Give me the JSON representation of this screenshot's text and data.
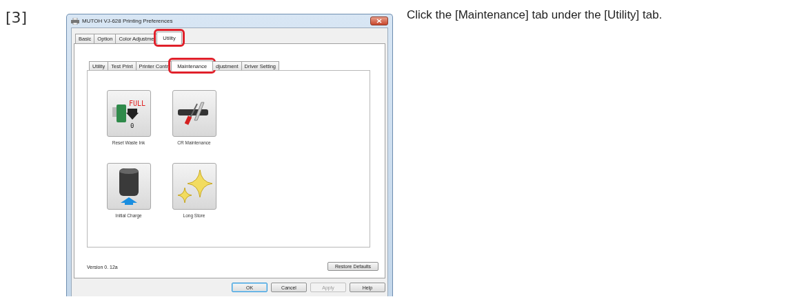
{
  "step": "[3]",
  "dialog": {
    "title": "MUTOH VJ-628 Printing Preferences",
    "tabs": [
      {
        "label": "Basic",
        "selected": false,
        "highlighted": false
      },
      {
        "label": "Option",
        "selected": false,
        "highlighted": false
      },
      {
        "label": "Color Adjustme",
        "selected": false,
        "highlighted": false
      },
      {
        "label": "Utility",
        "selected": true,
        "highlighted": true
      }
    ],
    "sub_tabs": [
      {
        "label": "Utility",
        "selected": false,
        "highlighted": false
      },
      {
        "label": "Test Print",
        "selected": false,
        "highlighted": false
      },
      {
        "label": "Printer Contr",
        "selected": false,
        "highlighted": false
      },
      {
        "label": "Maintenance",
        "selected": true,
        "highlighted": true
      },
      {
        "label": "djustment",
        "selected": false,
        "highlighted": false
      },
      {
        "label": "Driver Setting",
        "selected": false,
        "highlighted": false
      }
    ],
    "tools": [
      {
        "kind": "waste-ink",
        "label": "Reset Waste Ink",
        "badge": "FULL",
        "count": "0"
      },
      {
        "kind": "cr-maintenance",
        "label": "CR Maintenance"
      },
      {
        "kind": "ink-charge",
        "label": "Initial Charge"
      },
      {
        "kind": "long-store",
        "label": "Long Store"
      }
    ],
    "version": "Version 0. 12a",
    "restore_button": "Restore Defaults",
    "buttons": [
      {
        "label": "OK",
        "disabled": false,
        "default": true
      },
      {
        "label": "Cancel",
        "disabled": false,
        "default": false
      },
      {
        "label": "Apply",
        "disabled": true,
        "default": false
      },
      {
        "label": "Help",
        "disabled": false,
        "default": false
      }
    ]
  },
  "instruction": "Click the [Maintenance] tab under the [Utility] tab."
}
